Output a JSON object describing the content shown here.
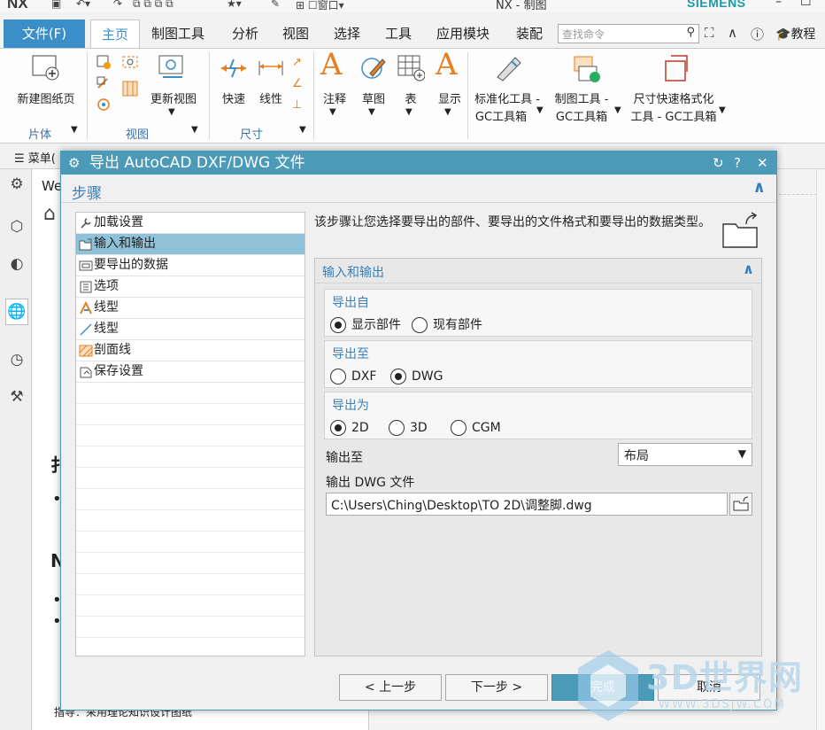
{
  "titlebar": {
    "app_logo": "NX",
    "window_title": "NX - 制图",
    "brand": "SIEMENS",
    "window_menu_label": "窗口"
  },
  "ribbon_tabs": {
    "file": "文件(F)",
    "tabs": [
      "主页",
      "制图工具",
      "分析",
      "视图",
      "选择",
      "工具",
      "应用模块",
      "装配"
    ],
    "active": "主页",
    "search_placeholder": "查找命令",
    "tutorial": "教程"
  },
  "ribbon": {
    "new_sheet": "新建图纸页",
    "group_sheet": "片体",
    "update_view": "更新视图",
    "group_view": "视图",
    "rapid": "快速",
    "linear": "线性",
    "group_dimension": "尺寸",
    "note": "注释",
    "sketch": "草图",
    "table": "表",
    "display": "显示",
    "std_tool_1": "标准化工具 -",
    "std_tool_2": "GC工具箱",
    "draft_tool_1": "制图工具 -",
    "draft_tool_2": "GC工具箱",
    "dim_fmt_1": "尺寸快速格式化",
    "dim_fmt_2": "工具 - GC工具箱"
  },
  "menurow": {
    "menu": "菜单("
  },
  "bgpage": {
    "we": "We",
    "frag1": "扌",
    "frag2": "N",
    "frag3": "指导：采用理论知识设计图纸"
  },
  "dialog": {
    "title": "导出 AutoCAD DXF/DWG 文件",
    "steps_header": "步骤",
    "steps": [
      {
        "label": "加载设置",
        "icon": "wrench-icon"
      },
      {
        "label": "输入和输出",
        "icon": "folder-open-icon"
      },
      {
        "label": "要导出的数据",
        "icon": "data-icon"
      },
      {
        "label": "选项",
        "icon": "options-icon"
      },
      {
        "label": "线型",
        "icon": "linetype-icon"
      },
      {
        "label": "线型",
        "icon": "line-icon"
      },
      {
        "label": "剖面线",
        "icon": "hatch-icon"
      },
      {
        "label": "保存设置",
        "icon": "save-settings-icon"
      }
    ],
    "selected_step": "输入和输出",
    "description": "该步骤让您选择要导出的部件、要导出的文件格式和要导出的数据类型。",
    "group_title": "输入和输出",
    "export_from": {
      "title": "导出自",
      "options": [
        "显示部件",
        "现有部件"
      ],
      "selected": "显示部件"
    },
    "export_to": {
      "title": "导出至",
      "options": [
        "DXF",
        "DWG"
      ],
      "selected": "DWG"
    },
    "export_as": {
      "title": "导出为",
      "options": [
        "2D",
        "3D",
        "CGM"
      ],
      "selected": "2D"
    },
    "output_to_label": "输出至",
    "output_to_value": "布局",
    "output_file_label": "输出 DWG 文件",
    "output_file_value": "C:\\Users\\Ching\\Desktop\\TO 2D\\调整脚.dwg",
    "buttons": {
      "back": "< 上一步",
      "next": "下一步 >",
      "finish": "完成",
      "cancel": "取消"
    }
  },
  "watermark": {
    "text": "3D世界网",
    "url": "WWW.3DSJW.COM"
  },
  "colors": {
    "accent": "#4a9ab8",
    "file_tab": "#3b8fc9",
    "selected_step": "#8fc1d8",
    "section_title": "#3b7fb8",
    "brand": "#1b9aaa"
  }
}
